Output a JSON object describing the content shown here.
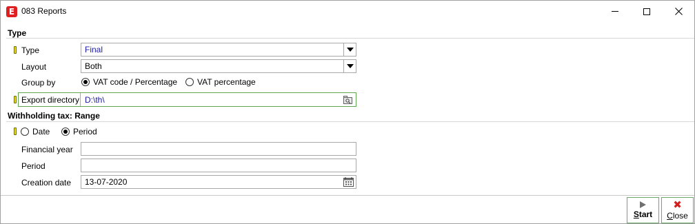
{
  "window": {
    "title": "083 Reports",
    "app_icon_letter": "E",
    "minimize_label": "",
    "maximize_label": "",
    "close_label": ""
  },
  "type_section": {
    "header": "Type",
    "type": {
      "label": "Type",
      "value": "Final"
    },
    "layout": {
      "label": "Layout",
      "value": "Both"
    },
    "group_by": {
      "label": "Group by",
      "options": [
        "VAT code / Percentage",
        "VAT percentage"
      ],
      "selected": "VAT code / Percentage"
    },
    "export_directory": {
      "label": "Export directory",
      "value": "D:\\th\\"
    }
  },
  "range_section": {
    "header": "Withholding tax: Range",
    "range_mode": {
      "options": [
        "Date",
        "Period"
      ],
      "selected": "Period"
    },
    "financial_year": {
      "label": "Financial year",
      "value": ""
    },
    "period": {
      "label": "Period",
      "value": ""
    },
    "creation_date": {
      "label": "Creation date",
      "value": "13-07-2020"
    }
  },
  "footer": {
    "start_label": "Start",
    "close_label": "Close"
  },
  "colors": {
    "required_marker": "#f0e000",
    "focus_border": "#5aa84a",
    "value_blue": "#1a1aa0",
    "close_icon_red": "#d02020",
    "app_icon_red": "#e02020"
  }
}
